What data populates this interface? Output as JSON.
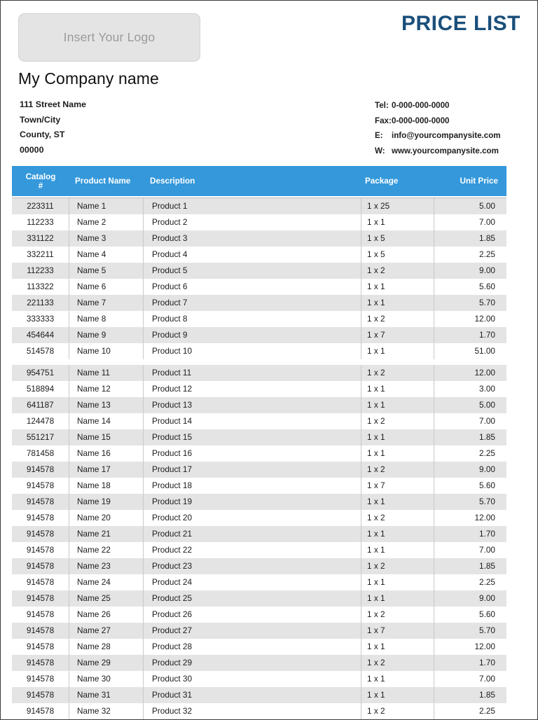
{
  "document": {
    "title": "PRICE LIST",
    "logo_placeholder": "Insert Your Logo",
    "company_name": "My Company name"
  },
  "address": {
    "line1": "111 Street Name",
    "line2": "Town/City",
    "line3": "County, ST",
    "line4": "00000"
  },
  "contact": {
    "tel_label": "Tel:",
    "tel_value": "0-000-000-0000",
    "fax_label": "Fax:",
    "fax_value": "0-000-000-0000",
    "email_label": "E:",
    "email_value": "info@yourcompanysite.com",
    "web_label": "W:",
    "web_value": "www.yourcompanysite.com"
  },
  "colors": {
    "header_blue": "#3498db",
    "title_navy": "#1a4f7a",
    "row_stripe": "#e4e4e4",
    "logo_fill": "#e4e4e4"
  },
  "table": {
    "columns": [
      "Catalog\n#",
      "Product Name",
      "Description",
      "Package",
      "Unit Price"
    ],
    "column_catalog_line1": "Catalog",
    "column_catalog_line2": "#",
    "column_name": "Product Name",
    "column_description": "Description",
    "column_package": "Package",
    "column_unit_price": "Unit Price",
    "rows": [
      {
        "catalog": "223311",
        "name": "Name 1",
        "description": "Product 1",
        "package": "1 x 25",
        "price": "5.00"
      },
      {
        "catalog": "112233",
        "name": "Name 2",
        "description": "Product 2",
        "package": "1 x 1",
        "price": "7.00"
      },
      {
        "catalog": "331122",
        "name": "Name 3",
        "description": "Product 3",
        "package": "1 x 5",
        "price": "1.85"
      },
      {
        "catalog": "332211",
        "name": "Name 4",
        "description": "Product 4",
        "package": "1 x 5",
        "price": "2.25"
      },
      {
        "catalog": "112233",
        "name": "Name 5",
        "description": "Product 5",
        "package": "1 x 2",
        "price": "9.00"
      },
      {
        "catalog": "113322",
        "name": "Name 6",
        "description": "Product 6",
        "package": "1 x 1",
        "price": "5.60"
      },
      {
        "catalog": "221133",
        "name": "Name 7",
        "description": "Product 7",
        "package": "1 x 1",
        "price": "5.70"
      },
      {
        "catalog": "333333",
        "name": "Name 8",
        "description": "Product 8",
        "package": "1 x 2",
        "price": "12.00"
      },
      {
        "catalog": "454644",
        "name": "Name 9",
        "description": "Product 9",
        "package": "1 x 7",
        "price": "1.70"
      },
      {
        "catalog": "514578",
        "name": "Name 10",
        "description": "Product 10",
        "package": "1 x 1",
        "price": "51.00"
      },
      {
        "catalog": "954751",
        "name": "Name 11",
        "description": "Product 11",
        "package": "1 x 2",
        "price": "12.00"
      },
      {
        "catalog": "518894",
        "name": "Name 12",
        "description": "Product 12",
        "package": "1 x 1",
        "price": "3.00"
      },
      {
        "catalog": "641187",
        "name": "Name 13",
        "description": "Product 13",
        "package": "1 x 1",
        "price": "5.00"
      },
      {
        "catalog": "124478",
        "name": "Name 14",
        "description": "Product 14",
        "package": "1 x 2",
        "price": "7.00"
      },
      {
        "catalog": "551217",
        "name": "Name 15",
        "description": "Product 15",
        "package": "1 x 1",
        "price": "1.85"
      },
      {
        "catalog": "781458",
        "name": "Name 16",
        "description": "Product 16",
        "package": "1 x 1",
        "price": "2.25"
      },
      {
        "catalog": "914578",
        "name": "Name 17",
        "description": "Product 17",
        "package": "1 x 2",
        "price": "9.00"
      },
      {
        "catalog": "914578",
        "name": "Name 18",
        "description": "Product 18",
        "package": "1 x 7",
        "price": "5.60"
      },
      {
        "catalog": "914578",
        "name": "Name 19",
        "description": "Product 19",
        "package": "1 x 1",
        "price": "5.70"
      },
      {
        "catalog": "914578",
        "name": "Name 20",
        "description": "Product 20",
        "package": "1 x 2",
        "price": "12.00"
      },
      {
        "catalog": "914578",
        "name": "Name 21",
        "description": "Product 21",
        "package": "1 x 1",
        "price": "1.70"
      },
      {
        "catalog": "914578",
        "name": "Name 22",
        "description": "Product 22",
        "package": "1 x 1",
        "price": "7.00"
      },
      {
        "catalog": "914578",
        "name": "Name 23",
        "description": "Product 23",
        "package": "1 x 2",
        "price": "1.85"
      },
      {
        "catalog": "914578",
        "name": "Name 24",
        "description": "Product 24",
        "package": "1 x 1",
        "price": "2.25"
      },
      {
        "catalog": "914578",
        "name": "Name 25",
        "description": "Product 25",
        "package": "1 x 1",
        "price": "9.00"
      },
      {
        "catalog": "914578",
        "name": "Name 26",
        "description": "Product 26",
        "package": "1 x 2",
        "price": "5.60"
      },
      {
        "catalog": "914578",
        "name": "Name 27",
        "description": "Product 27",
        "package": "1 x 7",
        "price": "5.70"
      },
      {
        "catalog": "914578",
        "name": "Name 28",
        "description": "Product 28",
        "package": "1 x 1",
        "price": "12.00"
      },
      {
        "catalog": "914578",
        "name": "Name 29",
        "description": "Product 29",
        "package": "1 x 2",
        "price": "1.70"
      },
      {
        "catalog": "914578",
        "name": "Name 30",
        "description": "Product 30",
        "package": "1 x 1",
        "price": "7.00"
      },
      {
        "catalog": "914578",
        "name": "Name 31",
        "description": "Product 31",
        "package": "1 x 1",
        "price": "1.85"
      },
      {
        "catalog": "914578",
        "name": "Name 32",
        "description": "Product 32",
        "package": "1 x 2",
        "price": "2.25"
      }
    ],
    "page_break_after_row_index": 9
  }
}
